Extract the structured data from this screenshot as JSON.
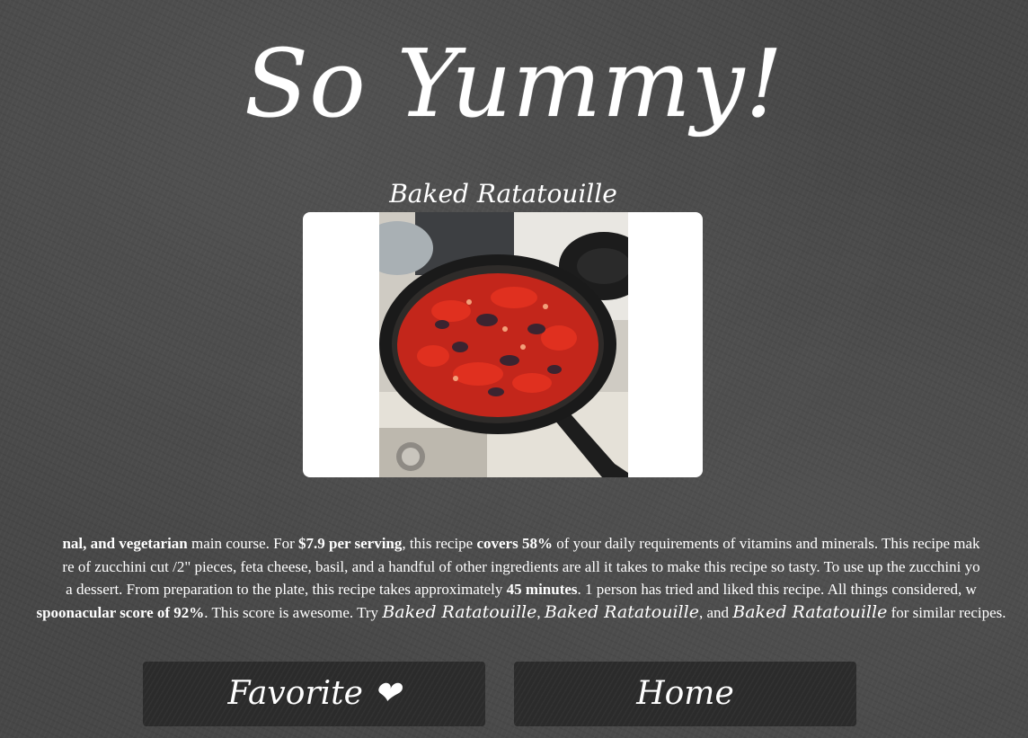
{
  "header": {
    "site_title": "So Yummy!"
  },
  "recipe": {
    "title": "Baked Ratatouille",
    "summary_lines": [
      {
        "segments": [
          {
            "t": "nal, and vegetarian",
            "b": true
          },
          {
            "t": " main course. For "
          },
          {
            "t": "$7.9 per serving",
            "b": true
          },
          {
            "t": ", this recipe "
          },
          {
            "t": "covers 58%",
            "b": true
          },
          {
            "t": " of your daily requirements of vitamins and minerals. This recipe mak"
          }
        ]
      },
      {
        "segments": [
          {
            "t": "re of zucchini cut /2\" pieces, feta cheese, basil, and a handful of other ingredients are all it takes to make this recipe so tasty. To use up the zucchini yo"
          }
        ]
      },
      {
        "segments": [
          {
            "t": " a dessert. From preparation to the plate, this recipe takes approximately "
          },
          {
            "t": "45 minutes",
            "b": true
          },
          {
            "t": ". 1 person has tried and liked this recipe. All things considered, w"
          }
        ]
      },
      {
        "segments": [
          {
            "t": "spoonacular score of 92%",
            "b": true
          },
          {
            "t": ". This score is awesome. Try "
          },
          {
            "t": "Baked Ratatouille",
            "link": true
          },
          {
            "t": ", "
          },
          {
            "t": "Baked Ratatouille",
            "link": true
          },
          {
            "t": ", and "
          },
          {
            "t": "Baked Ratatouille",
            "link": true
          },
          {
            "t": " for similar recipes."
          }
        ]
      }
    ]
  },
  "buttons": {
    "favorite_label": "Favorite ❤",
    "home_label": "Home"
  },
  "colors": {
    "background": "#474747",
    "button": "#2b2b2b",
    "text": "#ffffff"
  }
}
